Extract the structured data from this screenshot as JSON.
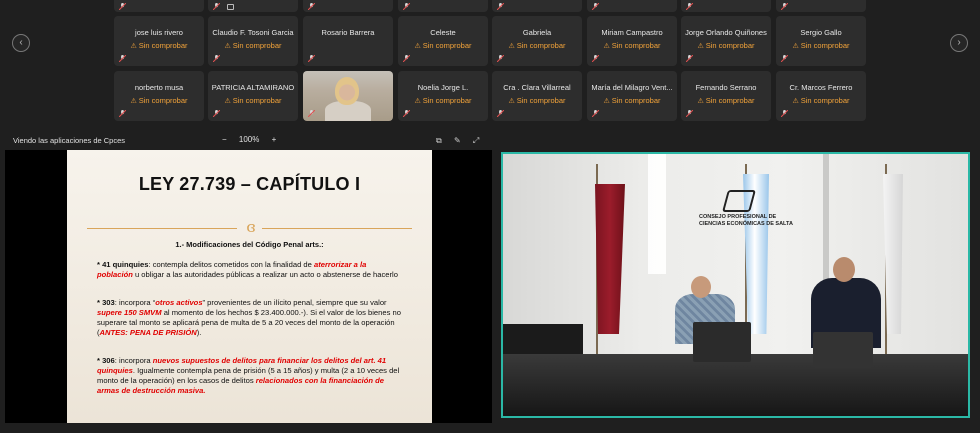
{
  "gallery": {
    "top_row_count": 9,
    "rows": [
      [
        {
          "name": "jose luis rivero",
          "status": "Sin comprobar"
        },
        {
          "name": "Claudio F. Tosoni Garcia",
          "status": "Sin comprobar"
        },
        {
          "name": "Rosario Barrera",
          "status": ""
        },
        {
          "name": "Celeste",
          "status": "Sin comprobar"
        },
        {
          "name": "Gabriela",
          "status": "Sin comprobar"
        },
        {
          "name": "Miriam Campastro",
          "status": "Sin comprobar"
        },
        {
          "name": "Jorge Orlando Quiñones",
          "status": "Sin comprobar"
        },
        {
          "name": "Sergio Gallo",
          "status": "Sin comprobar"
        }
      ],
      [
        {
          "name": "norberto musa",
          "status": "Sin comprobar"
        },
        {
          "name": "PATRICIA ALTAMIRANO",
          "status": "Sin comprobar"
        },
        {
          "name": "",
          "status": "",
          "video": true
        },
        {
          "name": "Noelia Jorge L.",
          "status": "Sin comprobar"
        },
        {
          "name": "Cra . Clara Villarreal",
          "status": "Sin comprobar"
        },
        {
          "name": "María del Milagro Vent...",
          "status": "Sin comprobar"
        },
        {
          "name": "Fernando Serrano",
          "status": "Sin comprobar"
        },
        {
          "name": "Cr. Marcos Ferrero",
          "status": "Sin comprobar"
        }
      ]
    ]
  },
  "share_bar": {
    "title": "Viendo las aplicaciones de Cpces",
    "zoom_minus": "−",
    "zoom_level": "100%",
    "zoom_plus": "+"
  },
  "slide": {
    "title": "LEY 27.739 – CAPÍTULO I",
    "ornament": "ɞ",
    "subtitle": "1.- Modificaciones del Código Penal arts.:",
    "p1": {
      "bullet": "* 41 quinquies",
      "t1": ": contempla delitos cometidos con la finalidad de ",
      "red1": "aterrorizar a la población",
      "t2": " u obligar a las autoridades públicas a realizar un acto o abstenerse de hacerlo"
    },
    "p2": {
      "bullet": "* 303",
      "t1": ": incorpora “",
      "red1": "otros activos",
      "t2": "” provenientes de un ilícito penal, siempre que su valor ",
      "red2": "supere 150 SMVM",
      "t3": " al momento de los hechos $ 23.400.000.-). Si el valor de los bienes no superare tal monto se aplicará pena de multa de 5 a 20 veces del monto de la operación (",
      "red3": "ANTES: PENA DE PRISIÓN",
      "t4": ")."
    },
    "p3": {
      "bullet": "* 306",
      "t1": ": incorpora ",
      "red1": "nuevos supuestos de delitos para financiar los delitos del art. 41 quinquies",
      "t2": ". Igualmente contempla pena de prisión (5 a 15 años) y multa (2 a 10 veces del monto de la operación) en los casos de delitos ",
      "red2": "relacionados con la financiación de armas de destrucción masiva."
    }
  },
  "video": {
    "logo_text": "CONSEJO PROFESIONAL DE CIENCIAS ECONÓMICAS DE SALTA"
  }
}
